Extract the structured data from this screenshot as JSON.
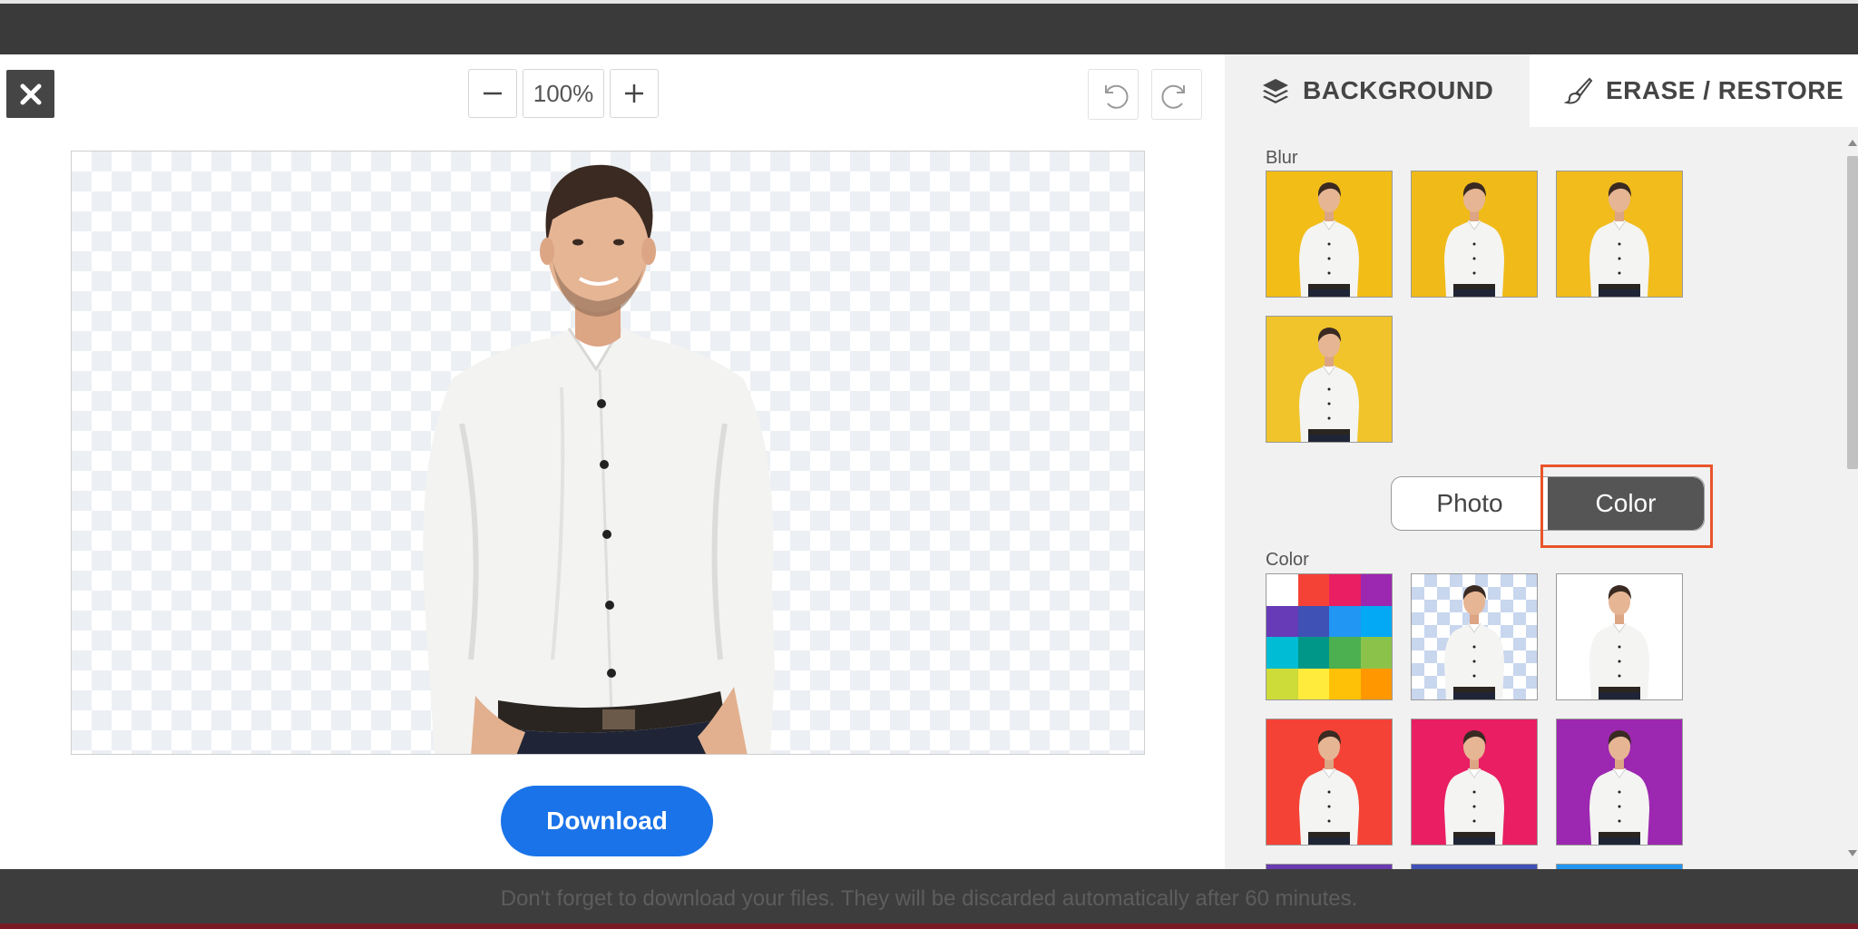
{
  "toolbar": {
    "zoom_level": "100%",
    "zoom_out_icon": "minus-icon",
    "zoom_in_icon": "plus-icon",
    "undo_icon": "undo-icon",
    "redo_icon": "redo-icon",
    "close_icon": "close-icon"
  },
  "main": {
    "download_label": "Download"
  },
  "panel": {
    "tabs": [
      {
        "label": "BACKGROUND",
        "icon": "layers-icon"
      },
      {
        "label": "ERASE / RESTORE",
        "icon": "brush-icon"
      }
    ],
    "blur_label": "Blur",
    "toggle": {
      "photo_label": "Photo",
      "color_label": "Color",
      "selected": "Color"
    },
    "color_label": "Color",
    "blur_thumbs": [
      "#f2bd17",
      "#f0bb18",
      "#f1bc1c",
      "#f0c42a"
    ],
    "color_thumbs": [
      {
        "kind": "palette"
      },
      {
        "kind": "transparent"
      },
      {
        "kind": "solid",
        "color": "#ffffff"
      },
      {
        "kind": "solid",
        "color": "#f44336"
      },
      {
        "kind": "solid",
        "color": "#e91e63"
      },
      {
        "kind": "solid",
        "color": "#9c27b0"
      }
    ],
    "palette_colors": [
      "#ffffff",
      "#f44336",
      "#e91e63",
      "#9c27b0",
      "#673ab7",
      "#3f51b5",
      "#2196f3",
      "#03a9f4",
      "#00bcd4",
      "#009688",
      "#4caf50",
      "#8bc34a",
      "#cddc39",
      "#ffeb3b",
      "#ffc107",
      "#ff9800"
    ]
  },
  "footer": {
    "notice": "Don't forget to download your files. They will be discarded automatically after 60 minutes."
  }
}
